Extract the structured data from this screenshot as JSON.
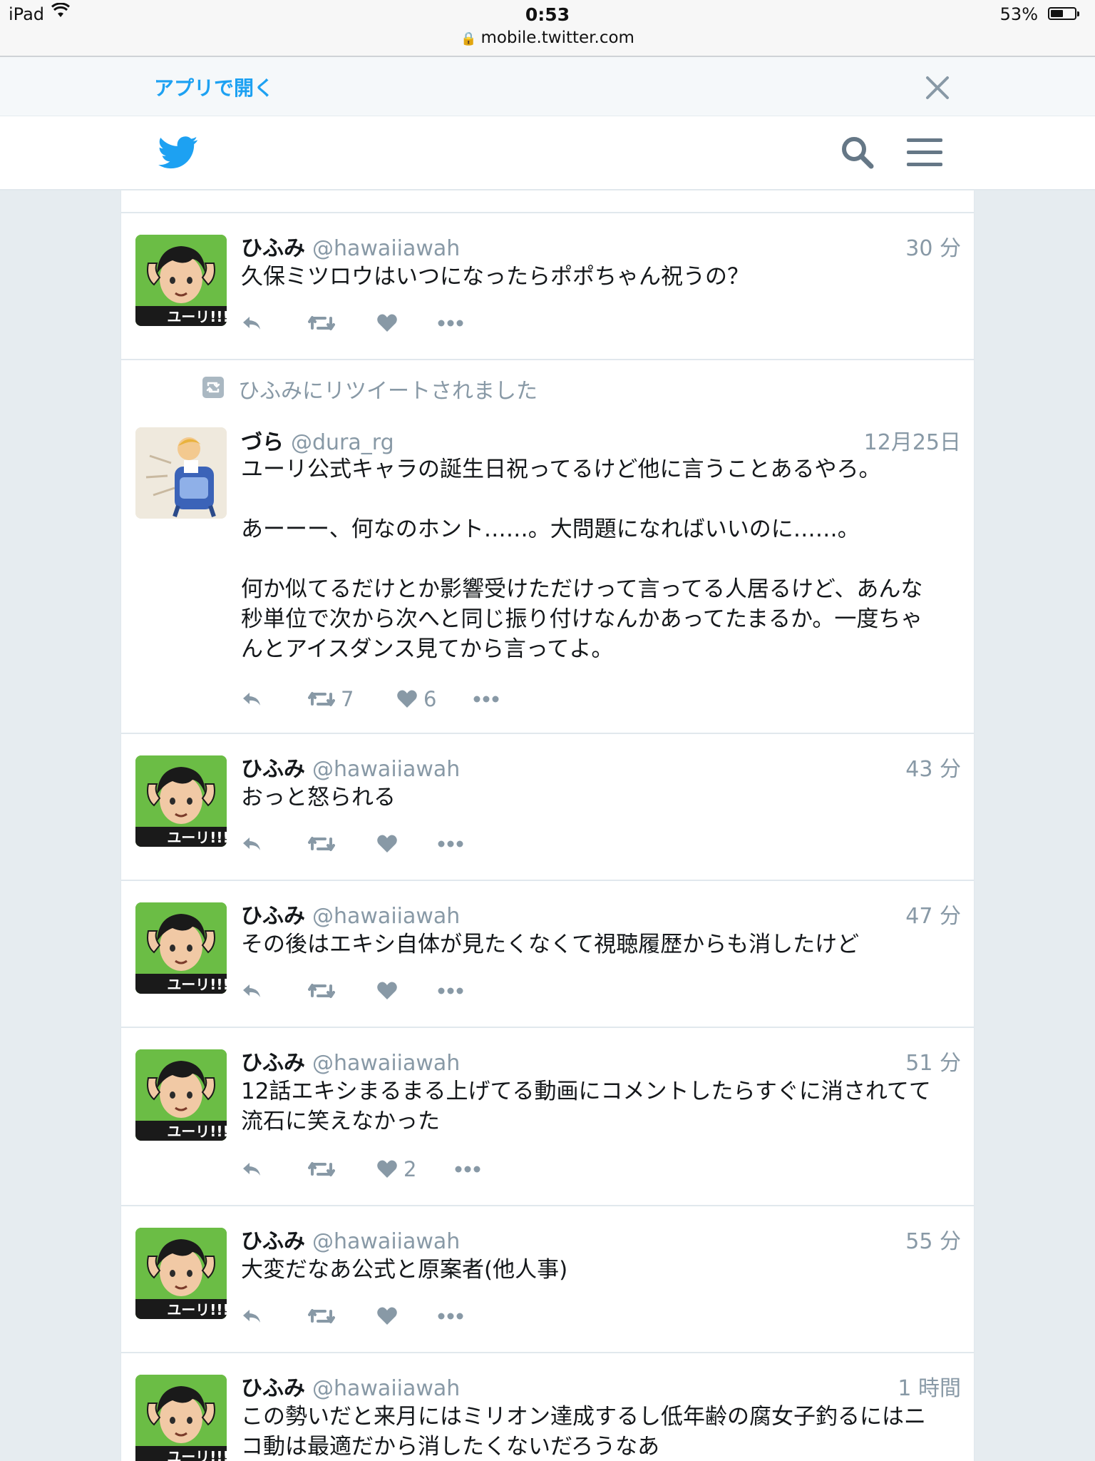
{
  "status_bar": {
    "device": "iPad",
    "time": "0:53",
    "url": "mobile.twitter.com",
    "battery": "53%",
    "battery_level": 0.53
  },
  "app_banner": {
    "open_in_app": "アプリで開く"
  },
  "nav": {
    "logo_icon": "twitter-bird-icon",
    "search_icon": "search-icon",
    "menu_icon": "hamburger-menu-icon"
  },
  "tweets": [
    {
      "name": "ひふみ",
      "handle": "@hawaiiawah",
      "time": "30 分",
      "text": "久保ミツロウはいつになったらポポちゃん祝うの？",
      "retweets": "",
      "likes": ""
    },
    {
      "retweeted_by": "ひふみにリツイートされました",
      "name": "づら",
      "handle": "@dura_rg",
      "time": "12月25日",
      "text": "ユーリ公式キャラの誕生日祝ってるけど他に言うことあるやろ。\n\nあーーー、何なのホント……。大問題になればいいのに……。\n\n何か似てるだけとか影響受けただけって言ってる人居るけど、あんな\n秒単位で次から次へと同じ振り付けなんかあってたまるか。一度ちゃ\nんとアイスダンス見てから言ってよ。",
      "retweets": "7",
      "likes": "6"
    },
    {
      "name": "ひふみ",
      "handle": "@hawaiiawah",
      "time": "43 分",
      "text": "おっと怒られる",
      "retweets": "",
      "likes": ""
    },
    {
      "name": "ひふみ",
      "handle": "@hawaiiawah",
      "time": "47 分",
      "text": "その後はエキシ自体が見たくなくて視聴履歴からも消したけど",
      "retweets": "",
      "likes": ""
    },
    {
      "name": "ひふみ",
      "handle": "@hawaiiawah",
      "time": "51 分",
      "text": "12話エキシまるまる上げてる動画にコメントしたらすぐに消されてて\n流石に笑えなかった",
      "retweets": "",
      "likes": "2"
    },
    {
      "name": "ひふみ",
      "handle": "@hawaiiawah",
      "time": "55 分",
      "text": "大変だなあ公式と原案者(他人事)",
      "retweets": "",
      "likes": ""
    },
    {
      "name": "ひふみ",
      "handle": "@hawaiiawah",
      "time": "1 時間",
      "text": "この勢いだと来月にはミリオン達成するし低年齢の腐女子釣るにはニ\nコ動は最適だから消したくないだろうなあ",
      "retweets": "",
      "likes": ""
    }
  ],
  "action_icons": [
    "reply-icon",
    "retweet-icon",
    "like-heart-icon",
    "more-dots-icon"
  ],
  "colors": {
    "accent": "#1da1f2",
    "muted": "#8899a6",
    "text": "#14171a",
    "background": "#e6ecf0"
  }
}
